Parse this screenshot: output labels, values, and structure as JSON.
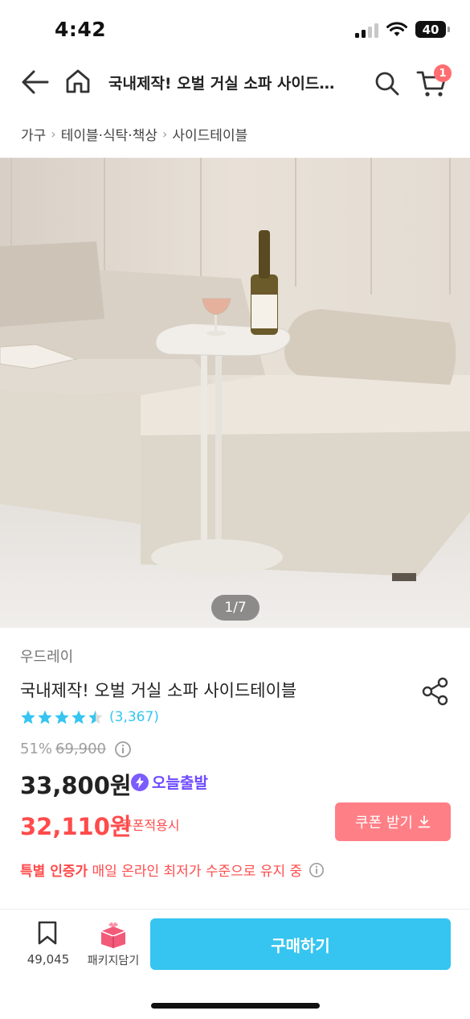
{
  "status": {
    "time": "4:42",
    "battery": "40"
  },
  "header": {
    "title": "국내제작! 오벌 거실 소파 사이드…",
    "cart_count": "1"
  },
  "breadcrumb": [
    "가구",
    "테이블·식탁·책상",
    "사이드테이블"
  ],
  "image_counter": "1/7",
  "product": {
    "brand": "우드레이",
    "name": "국내제작! 오벌 거실 소파 사이드테이블",
    "rating": 4.5,
    "review_count": "(3,367)",
    "discount": "51%",
    "original_price": "69,900",
    "price": "33,800원",
    "today_badge": "오늘출발",
    "coupon_price": "32,110원",
    "coupon_note": "쿠폰적용시",
    "coupon_button": "쿠폰 받기",
    "special_bold": "특별 인증가",
    "special_text": "매일 온라인 최저가 수준으로 유지 중"
  },
  "bottom": {
    "bookmark_count": "49,045",
    "package_label": "패키지담기",
    "buy_label": "구매하기"
  },
  "colors": {
    "accent": "#35c5f0",
    "coupon": "#ff7f86",
    "price_red": "#ff4b4b",
    "badge": "#ff6d70"
  }
}
